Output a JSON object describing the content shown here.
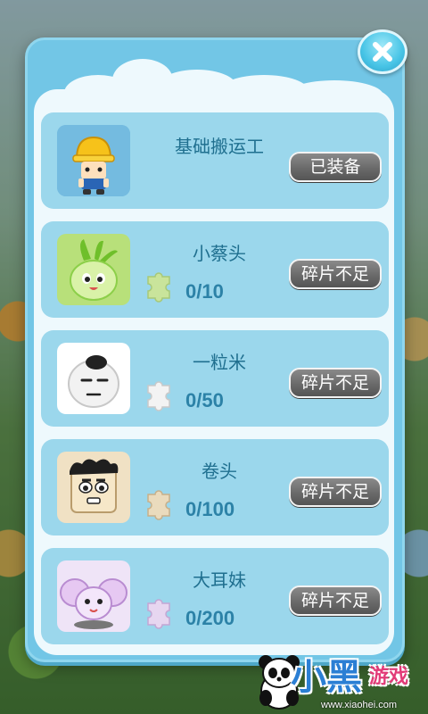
{
  "characters": [
    {
      "name": "基础搬运工",
      "button": "已装备",
      "avatar_icon": "worker-hardhat-icon"
    },
    {
      "name": "小蔡头",
      "progress": "0/10",
      "button": "碎片不足",
      "avatar_icon": "cabbage-icon"
    },
    {
      "name": "一粒米",
      "progress": "0/50",
      "button": "碎片不足",
      "avatar_icon": "rice-icon"
    },
    {
      "name": "卷头",
      "progress": "0/100",
      "button": "碎片不足",
      "avatar_icon": "curly-hair-box-icon"
    },
    {
      "name": "大耳妹",
      "progress": "0/200",
      "button": "碎片不足",
      "avatar_icon": "big-ear-girl-icon"
    }
  ],
  "close_icon": "close-icon",
  "watermark": {
    "big": "小黑",
    "small": "游戏",
    "url": "www.xiaohei.com"
  },
  "colors": {
    "panel": "#72c6e6",
    "card": "#9bd7ec",
    "name_text": "#1f6f8f",
    "progress_text": "#2c82a7",
    "button": "#6a6a6a"
  }
}
